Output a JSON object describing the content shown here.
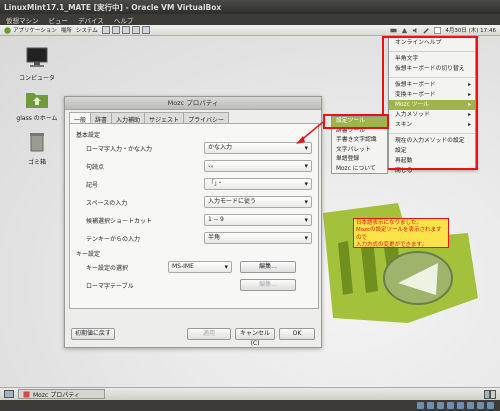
{
  "window": {
    "title": "LinuxMint17.1_MATE [実行中] - Oracle VM VirtualBox"
  },
  "vbox_menu": [
    "仮想マシン",
    "ビュー",
    "デバイス",
    "ヘルプ"
  ],
  "top_panel": {
    "menus": [
      "アプリケーション",
      "場所",
      "システム"
    ],
    "datetime": "4月30日 (木) 17:46"
  },
  "desktop": {
    "icons": [
      {
        "label": "コンピュータ"
      },
      {
        "label": "glass のホーム"
      },
      {
        "label": "ゴミ箱"
      }
    ]
  },
  "mozc_dialog": {
    "title": "Mozc プロパティ",
    "tabs": [
      "一般",
      "辞書",
      "入力補助",
      "サジェスト",
      "プライバシー"
    ],
    "basic_group": "基本設定",
    "rows": [
      {
        "label": "ローマ字入力・かな入力",
        "value": "かな入力"
      },
      {
        "label": "句読点",
        "value": "、。"
      },
      {
        "label": "記号",
        "value": "「」・"
      },
      {
        "label": "スペースの入力",
        "value": "入力モードに従う"
      },
      {
        "label": "候補選択ショートカット",
        "value": "1 -- 9"
      },
      {
        "label": "テンキーからの入力",
        "value": "半角"
      }
    ],
    "key_group": "キー設定",
    "keymap_label": "キー設定の選択",
    "keymap_value": "MS-IME",
    "edit_label": "編集...",
    "romaji_label": "ローマ字テーブル",
    "edit_label_disabled": "編集...",
    "reset_label": "初期値に戻す",
    "apply_label": "適用",
    "cancel_label": "キャンセル(C)",
    "ok_label": "OK"
  },
  "context_menu": {
    "items": [
      {
        "label": "オンラインヘルプ",
        "type": "item"
      },
      {
        "label": "",
        "type": "sep"
      },
      {
        "label": "半角文字",
        "type": "item"
      },
      {
        "label": "仮想キーボードの切り替え",
        "type": "item"
      },
      {
        "label": "",
        "type": "sep"
      },
      {
        "label": "仮想キーボード",
        "type": "sub"
      },
      {
        "label": "変換キーボード",
        "type": "sub"
      },
      {
        "label": "Mozc ツール",
        "type": "sub-hl"
      },
      {
        "label": "入力メソッド",
        "type": "sub"
      },
      {
        "label": "スキン",
        "type": "sub"
      },
      {
        "label": "",
        "type": "sep"
      },
      {
        "label": "現在の入力メソッドの設定",
        "type": "item"
      },
      {
        "label": "設定",
        "type": "item"
      },
      {
        "label": "再起動",
        "type": "item"
      },
      {
        "label": "閉じる",
        "type": "item"
      }
    ]
  },
  "submenu": {
    "items": [
      "設定ツール",
      "辞書ツール",
      "手書き文字認識",
      "文字パレット",
      "単語登録",
      "Mozc について"
    ]
  },
  "note": {
    "lines": [
      "日本語表示になりました。",
      "Mozcの設定ツールを表示されますので",
      "入力方式の変更ができます。"
    ]
  },
  "taskbar": {
    "task_label": "Mozc プロパティ"
  }
}
